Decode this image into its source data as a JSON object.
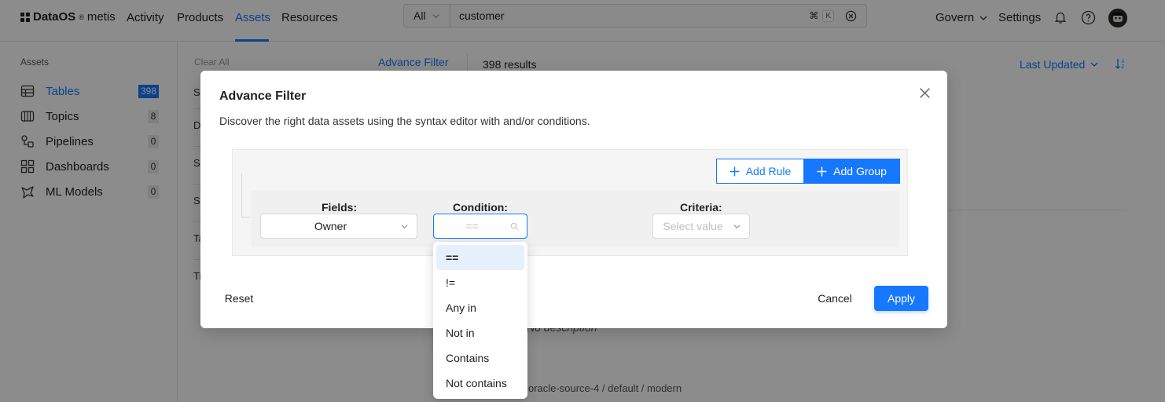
{
  "nav": {
    "logo_brand": "DataOS",
    "logo_reg": "®",
    "logo_product": "metis",
    "links": [
      {
        "label": "Activity"
      },
      {
        "label": "Products"
      },
      {
        "label": "Assets"
      },
      {
        "label": "Resources"
      }
    ],
    "active_link": "Assets",
    "search": {
      "scope": "All",
      "query": "customer",
      "shortcut_key": "K"
    },
    "govern_label": "Govern",
    "settings_label": "Settings",
    "accent_color": "#1677ff"
  },
  "sidebar": {
    "heading": "Assets",
    "items": [
      {
        "label": "Tables",
        "count": "398",
        "icon": "table-icon",
        "active": true
      },
      {
        "label": "Topics",
        "count": "8",
        "icon": "topic-icon"
      },
      {
        "label": "Pipelines",
        "count": "0",
        "icon": "pipeline-icon"
      },
      {
        "label": "Dashboards",
        "count": "0",
        "icon": "dashboard-icon"
      },
      {
        "label": "ML Models",
        "count": "0",
        "icon": "ml-model-icon"
      }
    ]
  },
  "background": {
    "clear_all": "Clear All",
    "advance_filter": "Advance Filter",
    "results": "398 results",
    "sort_label": "Last Updated",
    "row_letters": [
      "S",
      "D",
      "S",
      "S",
      "Ta",
      "Ti"
    ],
    "description": "No description",
    "breadcrumb": "oracle-source-4  /  default  /  modern"
  },
  "modal": {
    "title": "Advance Filter",
    "subtitle": "Discover the right data assets using the syntax editor with and/or conditions.",
    "add_rule_label": "Add Rule",
    "add_group_label": "Add Group",
    "fields_label": "Fields:",
    "condition_label": "Condition:",
    "criteria_label": "Criteria:",
    "field_value": "Owner",
    "condition_value": "==",
    "criteria_placeholder": "Select value",
    "reset_label": "Reset",
    "cancel_label": "Cancel",
    "apply_label": "Apply"
  },
  "condition_dropdown": {
    "options": [
      "==",
      "!=",
      "Any in",
      "Not in",
      "Contains",
      "Not contains"
    ],
    "selected": "=="
  }
}
